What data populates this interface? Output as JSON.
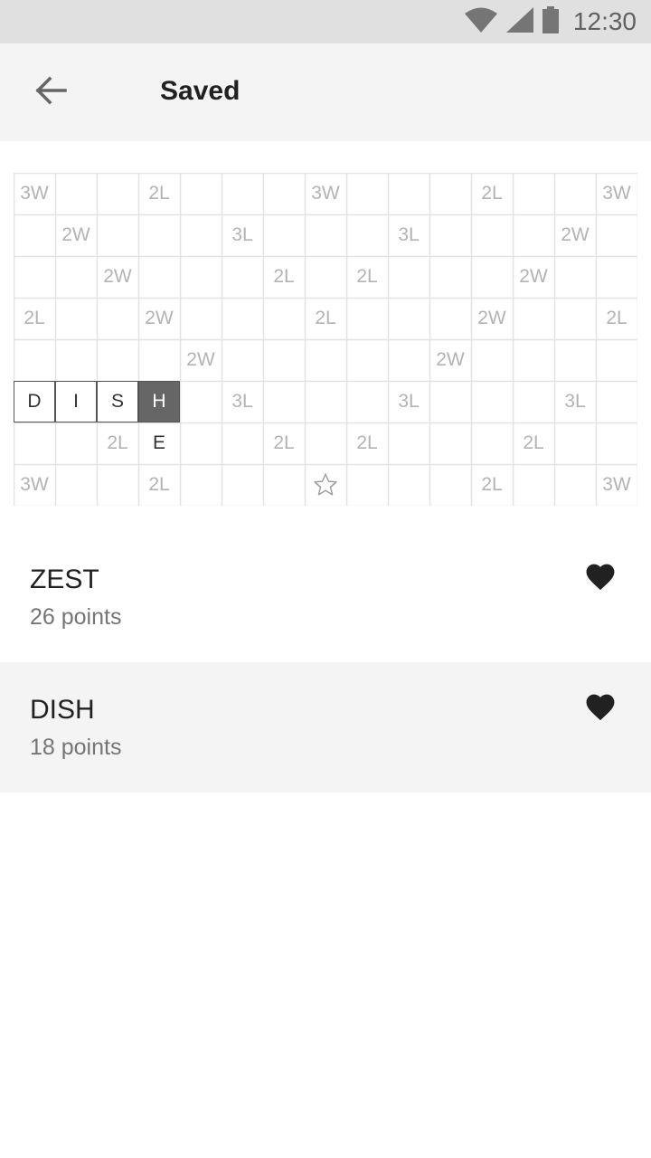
{
  "status_bar": {
    "time": "12:30"
  },
  "header": {
    "title": "Saved"
  },
  "board": {
    "rows": [
      [
        "3W",
        "",
        "",
        "2L",
        "",
        "",
        "",
        "3W",
        "",
        "",
        "",
        "2L",
        "",
        "",
        "3W"
      ],
      [
        "",
        "2W",
        "",
        "",
        "",
        "3L",
        "",
        "",
        "",
        "3L",
        "",
        "",
        "",
        "2W",
        ""
      ],
      [
        "",
        "",
        "2W",
        "",
        "",
        "",
        "2L",
        "",
        "2L",
        "",
        "",
        "",
        "2W",
        "",
        ""
      ],
      [
        "2L",
        "",
        "",
        "2W",
        "",
        "",
        "",
        "2L",
        "",
        "",
        "",
        "2W",
        "",
        "",
        "2L"
      ],
      [
        "",
        "",
        "",
        "",
        "2W",
        "",
        "",
        "",
        "",
        "",
        "2W",
        "",
        "",
        "",
        ""
      ],
      [
        "D",
        "I",
        "S",
        "H",
        "",
        "3L",
        "",
        "",
        "",
        "3L",
        "",
        "",
        "",
        "3L",
        ""
      ],
      [
        "",
        "",
        "2L",
        "E",
        "",
        "",
        "2L",
        "",
        "2L",
        "",
        "",
        "",
        "2L",
        "",
        ""
      ],
      [
        "3W",
        "",
        "",
        "2L",
        "",
        "",
        "",
        "*",
        "",
        "",
        "",
        "2L",
        "",
        "",
        "3W"
      ]
    ],
    "highlight_row": 5,
    "placed_cols": [
      0,
      1,
      2
    ],
    "last_col": 3
  },
  "saved_words": [
    {
      "word": "ZEST",
      "points": "26 points"
    },
    {
      "word": "DISH",
      "points": "18 points"
    }
  ]
}
